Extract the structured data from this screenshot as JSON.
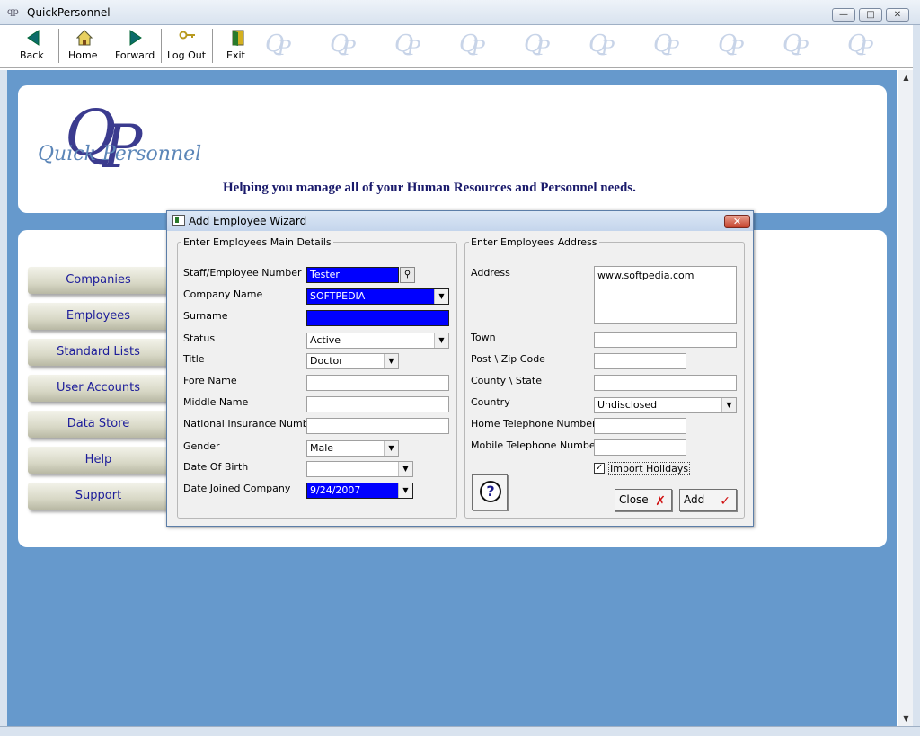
{
  "window": {
    "title": "QuickPersonnel",
    "app_icon": "qp"
  },
  "toolbar": {
    "buttons": [
      {
        "label": "Back",
        "icon": "back-arrow-icon"
      },
      {
        "label": "Home",
        "icon": "home-icon"
      },
      {
        "label": "Forward",
        "icon": "forward-arrow-icon"
      },
      {
        "label": "Log Out",
        "icon": "key-icon"
      },
      {
        "label": "Exit",
        "icon": "exit-door-icon"
      }
    ]
  },
  "header": {
    "logo_letters": "QP",
    "logo_text": "Quick Personnel",
    "tagline": "Helping you manage all of your Human Resources and Personnel needs."
  },
  "nav": {
    "items": [
      "Companies",
      "Employees",
      "Standard Lists",
      "User Accounts",
      "Data Store",
      "Help",
      "Support"
    ]
  },
  "dialog": {
    "title": "Add Employee Wizard",
    "main_details": {
      "legend": "Enter Employees Main Details",
      "fields": {
        "staff_number": {
          "label": "Staff/Employee Number",
          "value": "Tester"
        },
        "company_name": {
          "label": "Company Name",
          "value": "SOFTPEDIA"
        },
        "surname": {
          "label": "Surname",
          "value": ""
        },
        "status": {
          "label": "Status",
          "value": "Active"
        },
        "title": {
          "label": "Title",
          "value": "Doctor"
        },
        "fore_name": {
          "label": "Fore Name",
          "value": ""
        },
        "middle_name": {
          "label": "Middle Name",
          "value": ""
        },
        "ni_number": {
          "label": "National Insurance Number",
          "value": ""
        },
        "gender": {
          "label": "Gender",
          "value": "Male"
        },
        "dob": {
          "label": "Date Of Birth",
          "value": ""
        },
        "date_joined": {
          "label": "Date Joined Company",
          "value": "9/24/2007"
        }
      }
    },
    "address": {
      "legend": "Enter Employees Address",
      "fields": {
        "address": {
          "label": "Address",
          "value": "www.softpedia.com"
        },
        "town": {
          "label": "Town",
          "value": ""
        },
        "post_code": {
          "label": "Post \\ Zip Code",
          "value": ""
        },
        "county": {
          "label": "County \\ State",
          "value": ""
        },
        "country": {
          "label": "Country",
          "value": "Undisclosed"
        },
        "home_phone": {
          "label": "Home Telephone Number",
          "value": ""
        },
        "mobile_phone": {
          "label": "Mobile Telephone Number",
          "value": ""
        }
      },
      "import_holidays": {
        "label": "Import Holidays",
        "checked": true
      }
    },
    "buttons": {
      "close": "Close",
      "add": "Add"
    }
  }
}
